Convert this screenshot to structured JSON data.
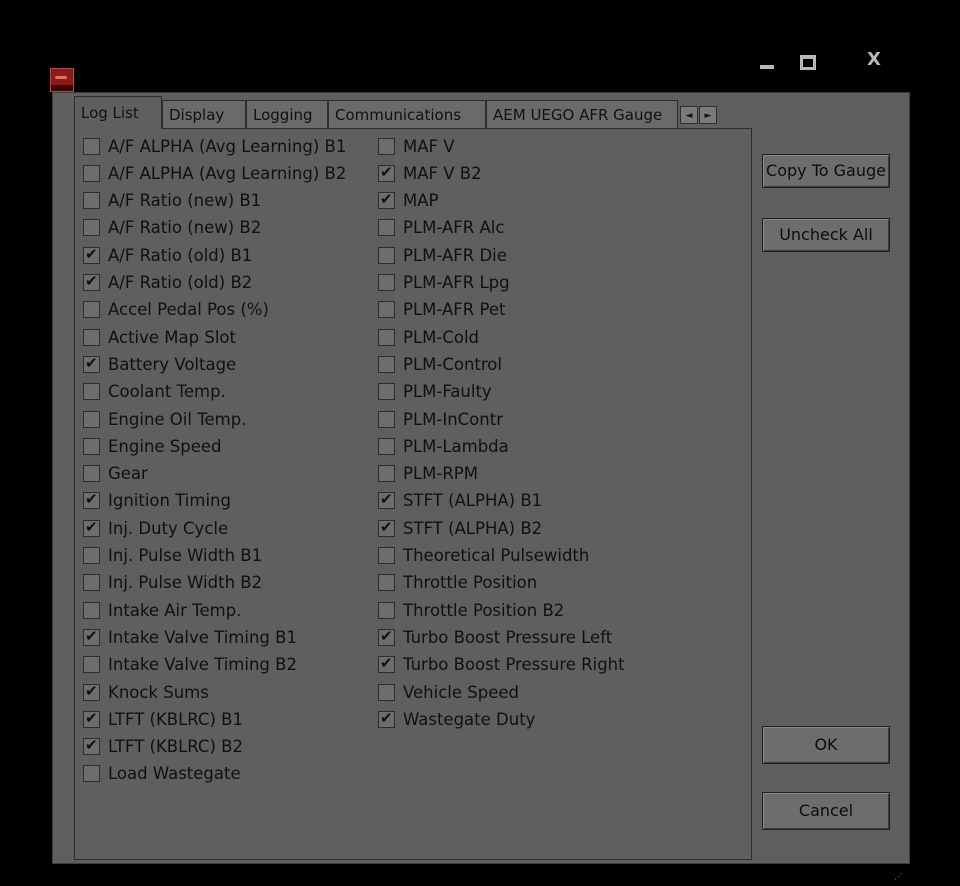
{
  "window": {
    "close_glyph": "X"
  },
  "tabs": [
    {
      "label": "Log List",
      "active": true
    },
    {
      "label": "Display",
      "active": false
    },
    {
      "label": "Logging",
      "active": false
    },
    {
      "label": "Communications",
      "active": false
    },
    {
      "label": "AEM UEGO AFR Gauge",
      "active": false
    }
  ],
  "tab_scroll": {
    "left": "◄",
    "right": "►"
  },
  "log_list": {
    "column1": [
      {
        "label": "A/F ALPHA (Avg Learning) B1",
        "checked": false
      },
      {
        "label": "A/F ALPHA (Avg Learning) B2",
        "checked": false
      },
      {
        "label": "A/F Ratio (new) B1",
        "checked": false
      },
      {
        "label": "A/F Ratio (new) B2",
        "checked": false
      },
      {
        "label": "A/F Ratio (old) B1",
        "checked": true
      },
      {
        "label": "A/F Ratio (old) B2",
        "checked": true
      },
      {
        "label": "Accel Pedal Pos (%)",
        "checked": false
      },
      {
        "label": "Active Map Slot",
        "checked": false
      },
      {
        "label": "Battery Voltage",
        "checked": true
      },
      {
        "label": "Coolant Temp.",
        "checked": false
      },
      {
        "label": "Engine Oil Temp.",
        "checked": false
      },
      {
        "label": "Engine Speed",
        "checked": false
      },
      {
        "label": "Gear",
        "checked": false
      },
      {
        "label": "Ignition Timing",
        "checked": true
      },
      {
        "label": "Inj. Duty Cycle",
        "checked": true
      },
      {
        "label": "Inj. Pulse Width B1",
        "checked": false
      },
      {
        "label": "Inj. Pulse Width B2",
        "checked": false
      },
      {
        "label": "Intake Air Temp.",
        "checked": false
      },
      {
        "label": "Intake Valve Timing B1",
        "checked": true
      },
      {
        "label": "Intake Valve Timing B2",
        "checked": false
      },
      {
        "label": "Knock Sums",
        "checked": true
      },
      {
        "label": "LTFT (KBLRC) B1",
        "checked": true
      },
      {
        "label": "LTFT (KBLRC) B2",
        "checked": true
      },
      {
        "label": "Load Wastegate",
        "checked": false
      }
    ],
    "column2": [
      {
        "label": "MAF V",
        "checked": false
      },
      {
        "label": "MAF V B2",
        "checked": true
      },
      {
        "label": "MAP",
        "checked": true
      },
      {
        "label": "PLM-AFR Alc",
        "checked": false
      },
      {
        "label": "PLM-AFR Die",
        "checked": false
      },
      {
        "label": "PLM-AFR Lpg",
        "checked": false
      },
      {
        "label": "PLM-AFR Pet",
        "checked": false
      },
      {
        "label": "PLM-Cold",
        "checked": false
      },
      {
        "label": "PLM-Control",
        "checked": false
      },
      {
        "label": "PLM-Faulty",
        "checked": false
      },
      {
        "label": "PLM-InContr",
        "checked": false
      },
      {
        "label": "PLM-Lambda",
        "checked": false
      },
      {
        "label": "PLM-RPM",
        "checked": false
      },
      {
        "label": "STFT (ALPHA) B1",
        "checked": true
      },
      {
        "label": "STFT (ALPHA) B2",
        "checked": true
      },
      {
        "label": "Theoretical Pulsewidth",
        "checked": false
      },
      {
        "label": "Throttle Position",
        "checked": false
      },
      {
        "label": "Throttle Position B2",
        "checked": false
      },
      {
        "label": "Turbo Boost Pressure Left",
        "checked": true
      },
      {
        "label": "Turbo Boost Pressure Right",
        "checked": true
      },
      {
        "label": "Vehicle Speed",
        "checked": false
      },
      {
        "label": "Wastegate Duty",
        "checked": true
      }
    ]
  },
  "buttons": {
    "copy_to_gauge": "Copy To Gauge",
    "uncheck_all": "Uncheck All",
    "ok": "OK",
    "cancel": "Cancel"
  },
  "icons": {
    "app": "app-icon",
    "minimize": "minimize-icon",
    "maximize": "maximize-icon",
    "close": "close-icon",
    "scroll_left": "arrow-left-icon",
    "scroll_right": "arrow-right-icon",
    "resize_grip": "resize-grip-icon"
  }
}
